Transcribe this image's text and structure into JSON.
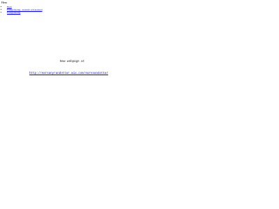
{
  "header": {
    "title": "Hem"
  },
  "nav": {
    "items": [
      {
        "label": "Hem"
      },
      {
        "label": "Fotografering - kvarnår och kostnad"
      },
      {
        "label": "Fotografering"
      }
    ]
  },
  "main": {
    "notice_text": "New webpage at",
    "new_url": "http://earsanyrandottar.wix.com/earsnandottar"
  },
  "colors": {
    "link": "#0000ee",
    "text": "#000000",
    "background": "#ffffff"
  }
}
